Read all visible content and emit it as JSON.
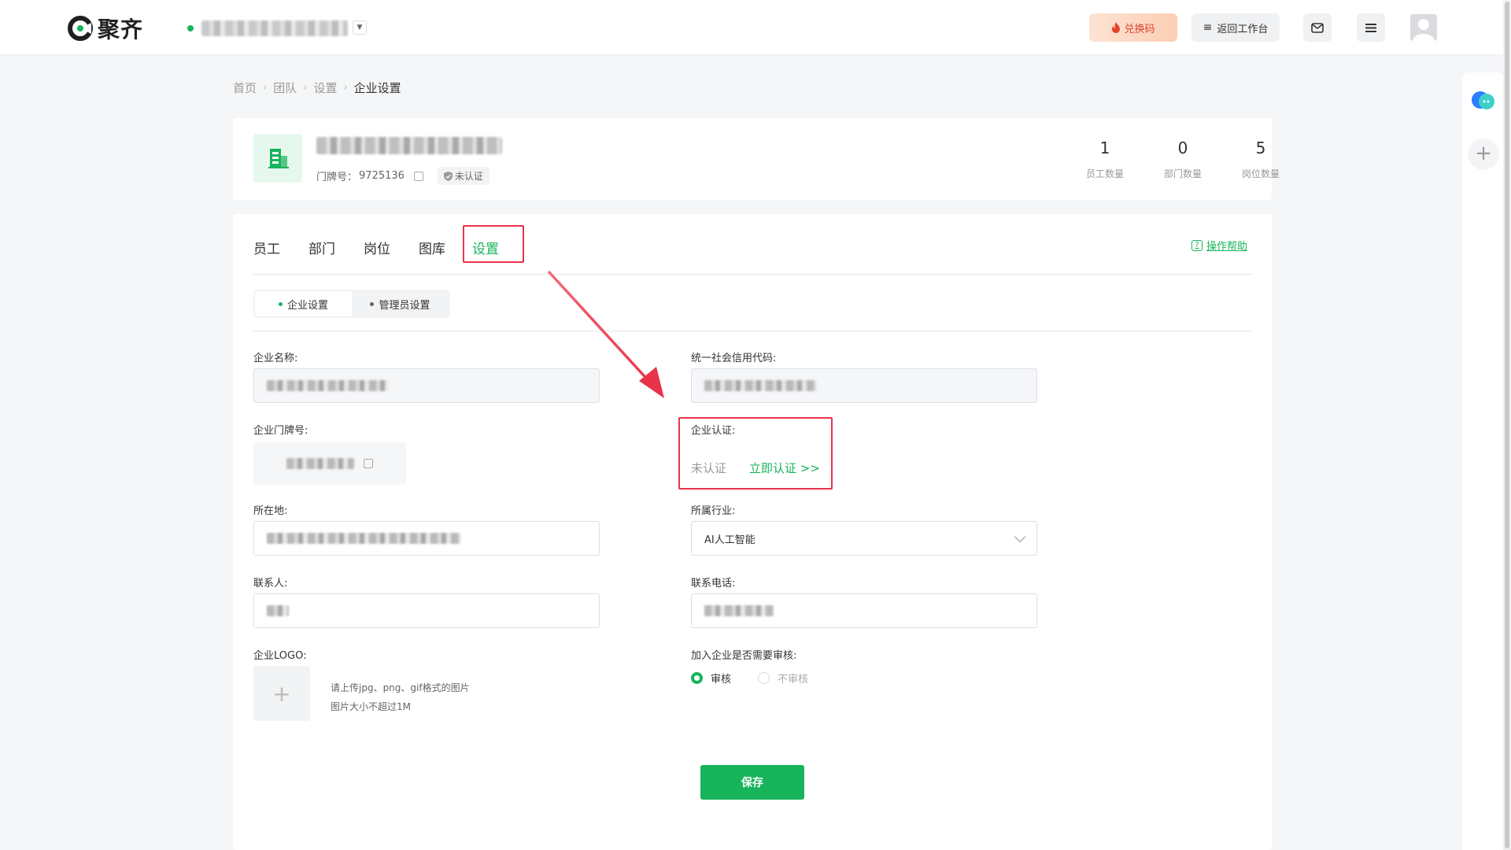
{
  "topbar": {
    "brand": "聚齐",
    "redeem_label": "兑换码",
    "workbench_label": "返回工作台"
  },
  "breadcrumb": [
    "首页",
    "团队",
    "设置",
    "企业设置"
  ],
  "company": {
    "doorplate_label": "门牌号：",
    "doorplate_value": "9725136",
    "badge": "未认证",
    "stats": [
      {
        "value": "1",
        "label": "员工数量"
      },
      {
        "value": "0",
        "label": "部门数量"
      },
      {
        "value": "5",
        "label": "岗位数量"
      }
    ]
  },
  "tabs": [
    "员工",
    "部门",
    "岗位",
    "图库",
    "设置"
  ],
  "active_tab": "设置",
  "help_label": "操作帮助",
  "subtabs": [
    "企业设置",
    "管理员设置"
  ],
  "form": {
    "name_label": "企业名称:",
    "credit_label": "统一社会信用代码:",
    "doorplate_label": "企业门牌号:",
    "verify_label": "企业认证:",
    "verify_status": "未认证",
    "verify_link": "立即认证 >>",
    "location_label": "所在地:",
    "industry_label": "所属行业:",
    "industry_value": "AI人工智能",
    "contact_label": "联系人:",
    "phone_label": "联系电话:",
    "logo_label": "企业LOGO:",
    "logo_hint_1": "请上传jpg、png、gif格式的图片",
    "logo_hint_2": "图片大小不超过1M",
    "review_label": "加入企业是否需要审核:",
    "review_yes": "审核",
    "review_no": "不审核",
    "review_selected": "审核",
    "save_label": "保存"
  },
  "colors": {
    "accent": "#17b45c",
    "highlight": "#e8344b"
  }
}
